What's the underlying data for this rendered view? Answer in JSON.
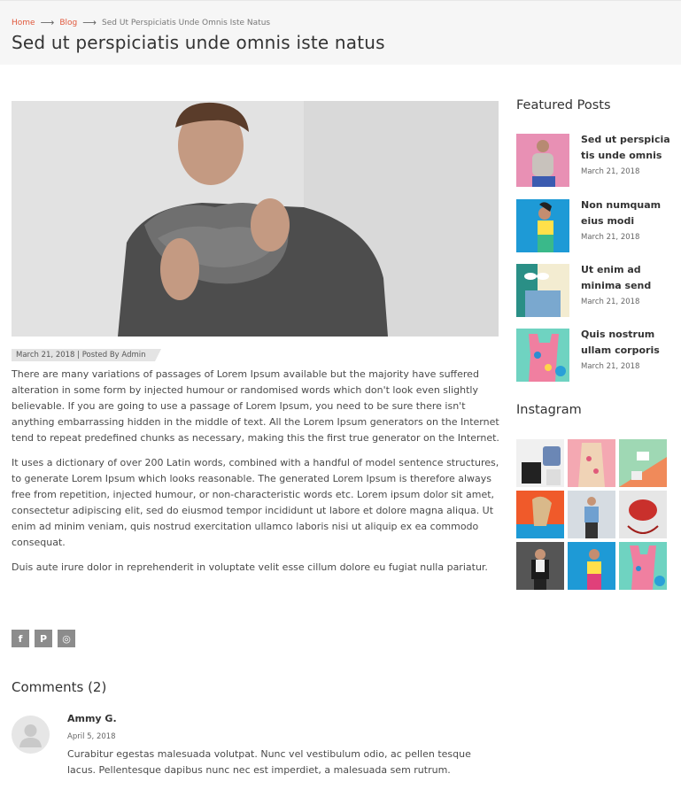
{
  "breadcrumb": {
    "home": "Home",
    "blog": "Blog",
    "current": "Sed Ut Perspiciatis Unde Omnis Iste Natus"
  },
  "page_title": "Sed ut perspiciatis unde omnis iste natus",
  "post_meta": "March 21, 2018 | Posted By Admin",
  "article": {
    "paragraphs": [
      "There are many variations of passages of Lorem Ipsum available but the majority have suffered alteration in some form by injected humour or randomised words which don't look even slightly believable. If you are going to use a passage of Lorem Ipsum, you need to be sure there isn't anything embarrassing hidden in the middle of text. All the Lorem Ipsum generators on the Internet tend to repeat predefined chunks as necessary, making this the first true generator on the Internet.",
      "It uses a dictionary of over 200 Latin words, combined with a handful of model sentence structures, to generate Lorem Ipsum which looks reasonable. The generated Lorem Ipsum is therefore always free from repetition, injected humour, or non-characteristic words etc. Lorem ipsum dolor sit amet, consectetur adipiscing elit, sed do eiusmod tempor incididunt ut labore et dolore magna aliqua. Ut enim ad minim veniam, quis nostrud exercitation ullamco laboris nisi ut aliquip ex ea commodo consequat.",
      "Duis aute irure dolor in reprehenderit in voluptate velit esse cillum dolore eu fugiat nulla pariatur."
    ]
  },
  "social": {
    "facebook": "f",
    "pinterest": "P",
    "instagram": "◎"
  },
  "comments": {
    "title": "Comments (2)",
    "items": [
      {
        "author": "Ammy G.",
        "date": "April 5, 2018",
        "text": "Curabitur egestas malesuada volutpat. Nunc vel vestibulum odio, ac pellen tesque lacus. Pellentesque dapibus nunc nec est imperdiet, a malesuada sem rutrum."
      }
    ]
  },
  "sidebar": {
    "featured_heading": "Featured Posts",
    "featured": [
      {
        "title": "Sed ut perspicia tis unde omnis",
        "date": "March 21, 2018"
      },
      {
        "title": "Non numquam eius modi",
        "date": "March 21, 2018"
      },
      {
        "title": "Ut enim ad minima send",
        "date": "March 21, 2018"
      },
      {
        "title": "Quis nostrum ullam corporis",
        "date": "March 21, 2018"
      }
    ],
    "instagram_heading": "Instagram"
  },
  "colors": {
    "accent": "#e0583c",
    "topbar_bg": "#f6f6f6",
    "social_bg": "#8c8c8c"
  }
}
